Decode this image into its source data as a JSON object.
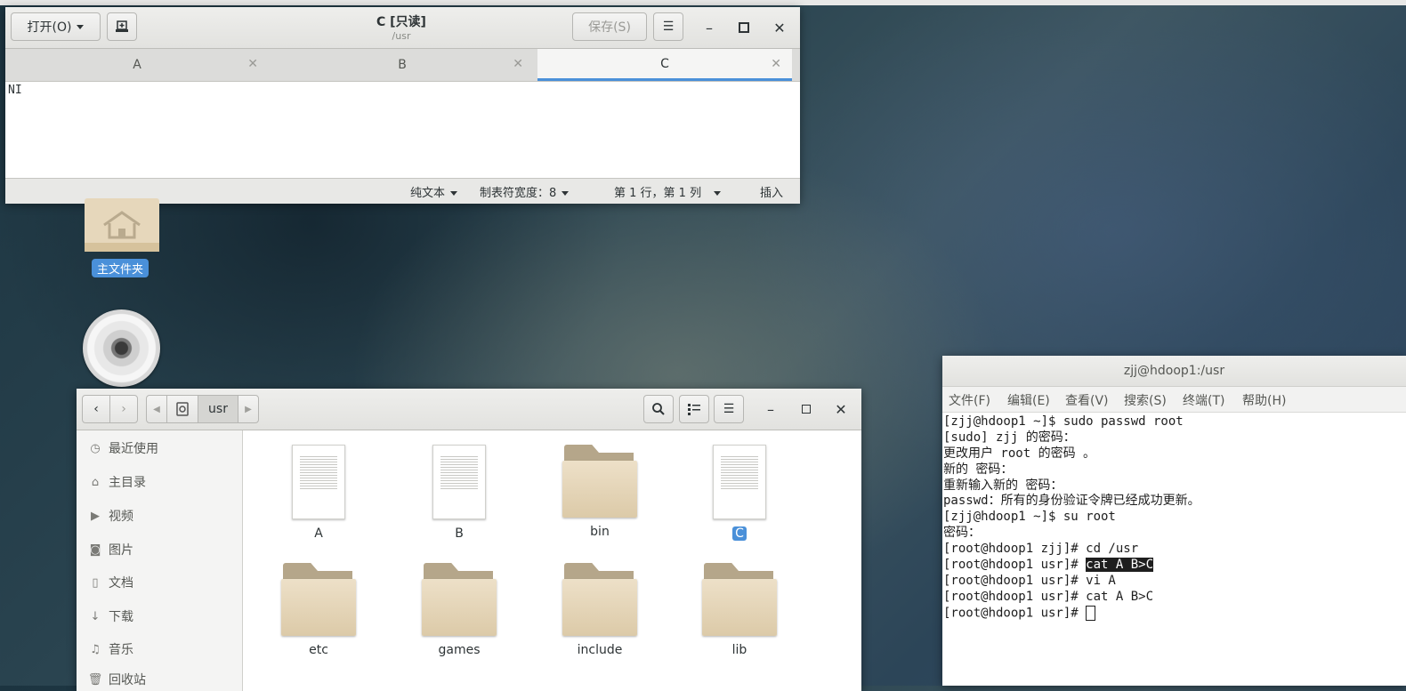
{
  "gedit": {
    "open_label": "打开(O)",
    "title": "C [只读]",
    "subtitle": "/usr",
    "save_label": "保存(S)",
    "tabs": [
      {
        "label": "A"
      },
      {
        "label": "B"
      },
      {
        "label": "C",
        "active": true
      }
    ],
    "content": "NI",
    "status": {
      "syntax": "纯文本",
      "tab_width": "制表符宽度：8",
      "position": "第 1 行，第 1 列",
      "mode": "插入"
    }
  },
  "desktop": {
    "home_label": "主文件夹"
  },
  "files": {
    "path_label": "usr",
    "sidebar": [
      {
        "label": "最近使用",
        "icon": "clock-icon"
      },
      {
        "label": "主目录",
        "icon": "home-icon"
      },
      {
        "label": "视频",
        "icon": "video-icon"
      },
      {
        "label": "图片",
        "icon": "camera-icon"
      },
      {
        "label": "文档",
        "icon": "document-icon"
      },
      {
        "label": "下载",
        "icon": "download-icon"
      },
      {
        "label": "音乐",
        "icon": "music-icon"
      },
      {
        "label": "回收站",
        "icon": "trash-icon"
      }
    ],
    "items": [
      {
        "label": "A",
        "kind": "file"
      },
      {
        "label": "B",
        "kind": "file"
      },
      {
        "label": "bin",
        "kind": "folder"
      },
      {
        "label": "C",
        "kind": "file",
        "selected": true
      },
      {
        "label": "etc",
        "kind": "folder"
      },
      {
        "label": "games",
        "kind": "folder"
      },
      {
        "label": "include",
        "kind": "folder"
      },
      {
        "label": "lib",
        "kind": "folder"
      }
    ]
  },
  "terminal": {
    "title": "zjj@hdoop1:/usr",
    "menu": [
      "文件(F)",
      "编辑(E)",
      "查看(V)",
      "搜索(S)",
      "终端(T)",
      "帮助(H)"
    ],
    "lines": [
      "[zjj@hdoop1 ~]$ sudo passwd root",
      "[sudo] zjj 的密码：",
      "更改用户 root 的密码 。",
      "新的 密码：",
      "重新输入新的 密码：",
      "passwd：所有的身份验证令牌已经成功更新。",
      "[zjj@hdoop1 ~]$ su root",
      "密码：",
      "[root@hdoop1 zjj]# cd /usr",
      "[root@hdoop1 usr]# ",
      "[root@hdoop1 usr]# vi A",
      "[root@hdoop1 usr]# cat A B>C",
      "[root@hdoop1 usr]# "
    ],
    "highlighted_command": "cat A B>C"
  },
  "colors": {
    "accent": "#4a90d9",
    "folder": "#dccaa8"
  }
}
